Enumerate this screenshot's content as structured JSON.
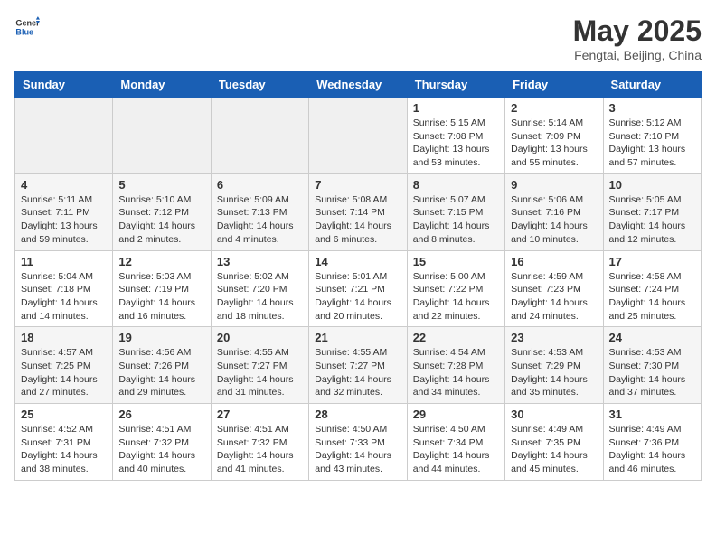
{
  "header": {
    "logo_general": "General",
    "logo_blue": "Blue",
    "title": "May 2025",
    "subtitle": "Fengtai, Beijing, China"
  },
  "days_of_week": [
    "Sunday",
    "Monday",
    "Tuesday",
    "Wednesday",
    "Thursday",
    "Friday",
    "Saturday"
  ],
  "weeks": [
    [
      {
        "day": "",
        "empty": true
      },
      {
        "day": "",
        "empty": true
      },
      {
        "day": "",
        "empty": true
      },
      {
        "day": "",
        "empty": true
      },
      {
        "day": "1",
        "sunrise": "5:15 AM",
        "sunset": "7:08 PM",
        "daylight": "13 hours and 53 minutes."
      },
      {
        "day": "2",
        "sunrise": "5:14 AM",
        "sunset": "7:09 PM",
        "daylight": "13 hours and 55 minutes."
      },
      {
        "day": "3",
        "sunrise": "5:12 AM",
        "sunset": "7:10 PM",
        "daylight": "13 hours and 57 minutes."
      }
    ],
    [
      {
        "day": "4",
        "sunrise": "5:11 AM",
        "sunset": "7:11 PM",
        "daylight": "13 hours and 59 minutes."
      },
      {
        "day": "5",
        "sunrise": "5:10 AM",
        "sunset": "7:12 PM",
        "daylight": "14 hours and 2 minutes."
      },
      {
        "day": "6",
        "sunrise": "5:09 AM",
        "sunset": "7:13 PM",
        "daylight": "14 hours and 4 minutes."
      },
      {
        "day": "7",
        "sunrise": "5:08 AM",
        "sunset": "7:14 PM",
        "daylight": "14 hours and 6 minutes."
      },
      {
        "day": "8",
        "sunrise": "5:07 AM",
        "sunset": "7:15 PM",
        "daylight": "14 hours and 8 minutes."
      },
      {
        "day": "9",
        "sunrise": "5:06 AM",
        "sunset": "7:16 PM",
        "daylight": "14 hours and 10 minutes."
      },
      {
        "day": "10",
        "sunrise": "5:05 AM",
        "sunset": "7:17 PM",
        "daylight": "14 hours and 12 minutes."
      }
    ],
    [
      {
        "day": "11",
        "sunrise": "5:04 AM",
        "sunset": "7:18 PM",
        "daylight": "14 hours and 14 minutes."
      },
      {
        "day": "12",
        "sunrise": "5:03 AM",
        "sunset": "7:19 PM",
        "daylight": "14 hours and 16 minutes."
      },
      {
        "day": "13",
        "sunrise": "5:02 AM",
        "sunset": "7:20 PM",
        "daylight": "14 hours and 18 minutes."
      },
      {
        "day": "14",
        "sunrise": "5:01 AM",
        "sunset": "7:21 PM",
        "daylight": "14 hours and 20 minutes."
      },
      {
        "day": "15",
        "sunrise": "5:00 AM",
        "sunset": "7:22 PM",
        "daylight": "14 hours and 22 minutes."
      },
      {
        "day": "16",
        "sunrise": "4:59 AM",
        "sunset": "7:23 PM",
        "daylight": "14 hours and 24 minutes."
      },
      {
        "day": "17",
        "sunrise": "4:58 AM",
        "sunset": "7:24 PM",
        "daylight": "14 hours and 25 minutes."
      }
    ],
    [
      {
        "day": "18",
        "sunrise": "4:57 AM",
        "sunset": "7:25 PM",
        "daylight": "14 hours and 27 minutes."
      },
      {
        "day": "19",
        "sunrise": "4:56 AM",
        "sunset": "7:26 PM",
        "daylight": "14 hours and 29 minutes."
      },
      {
        "day": "20",
        "sunrise": "4:55 AM",
        "sunset": "7:27 PM",
        "daylight": "14 hours and 31 minutes."
      },
      {
        "day": "21",
        "sunrise": "4:55 AM",
        "sunset": "7:27 PM",
        "daylight": "14 hours and 32 minutes."
      },
      {
        "day": "22",
        "sunrise": "4:54 AM",
        "sunset": "7:28 PM",
        "daylight": "14 hours and 34 minutes."
      },
      {
        "day": "23",
        "sunrise": "4:53 AM",
        "sunset": "7:29 PM",
        "daylight": "14 hours and 35 minutes."
      },
      {
        "day": "24",
        "sunrise": "4:53 AM",
        "sunset": "7:30 PM",
        "daylight": "14 hours and 37 minutes."
      }
    ],
    [
      {
        "day": "25",
        "sunrise": "4:52 AM",
        "sunset": "7:31 PM",
        "daylight": "14 hours and 38 minutes."
      },
      {
        "day": "26",
        "sunrise": "4:51 AM",
        "sunset": "7:32 PM",
        "daylight": "14 hours and 40 minutes."
      },
      {
        "day": "27",
        "sunrise": "4:51 AM",
        "sunset": "7:32 PM",
        "daylight": "14 hours and 41 minutes."
      },
      {
        "day": "28",
        "sunrise": "4:50 AM",
        "sunset": "7:33 PM",
        "daylight": "14 hours and 43 minutes."
      },
      {
        "day": "29",
        "sunrise": "4:50 AM",
        "sunset": "7:34 PM",
        "daylight": "14 hours and 44 minutes."
      },
      {
        "day": "30",
        "sunrise": "4:49 AM",
        "sunset": "7:35 PM",
        "daylight": "14 hours and 45 minutes."
      },
      {
        "day": "31",
        "sunrise": "4:49 AM",
        "sunset": "7:36 PM",
        "daylight": "14 hours and 46 minutes."
      }
    ]
  ]
}
